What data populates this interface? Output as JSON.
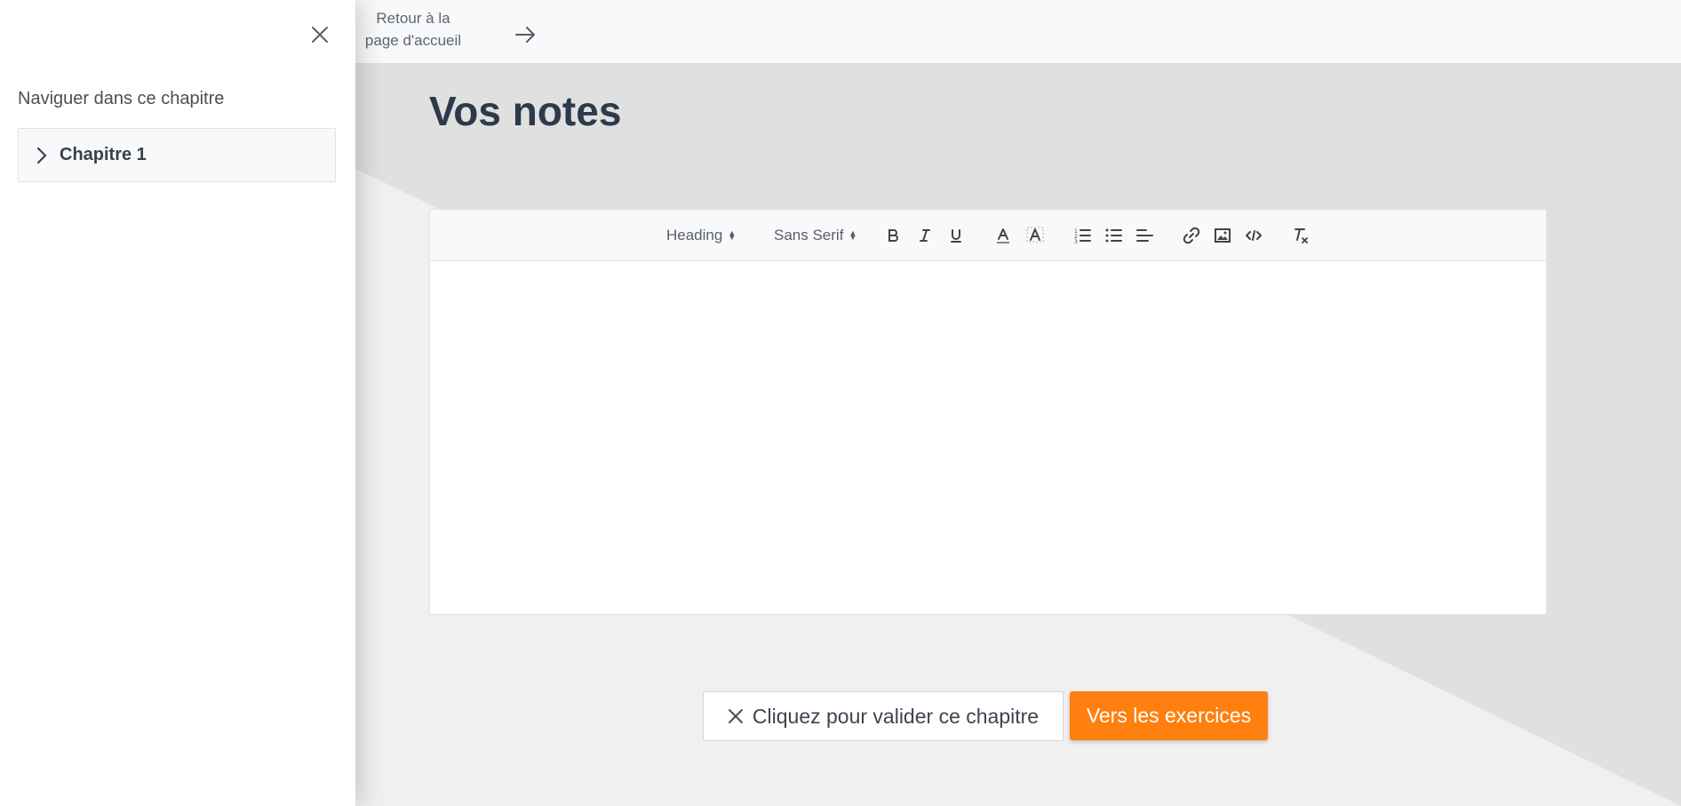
{
  "sidebar": {
    "title": "Naviguer dans ce chapitre",
    "close_icon": "close-icon",
    "items": [
      {
        "label": "Chapitre 1",
        "icon": "chevron-right-icon"
      }
    ]
  },
  "topbar": {
    "back_line1": "Retour à la",
    "back_line2": "page d'accueil",
    "back_icon": "arrow-right-icon"
  },
  "main": {
    "title": "Vos notes"
  },
  "editor": {
    "heading_select": "Heading",
    "font_select": "Sans Serif",
    "tools": [
      "bold-icon",
      "italic-icon",
      "underline-icon",
      "text-color-icon",
      "background-color-icon",
      "ordered-list-icon",
      "bullet-list-icon",
      "align-icon",
      "link-icon",
      "image-icon",
      "code-icon",
      "clear-format-icon"
    ]
  },
  "actions": {
    "validate_label": "Cliquez pour valider ce chapitre",
    "exercises_label": "Vers les exercices"
  },
  "colors": {
    "accent": "#ff7f0f",
    "title": "#2c3a4b",
    "background": "#f0f0f0",
    "band": "#e0e0e0"
  }
}
